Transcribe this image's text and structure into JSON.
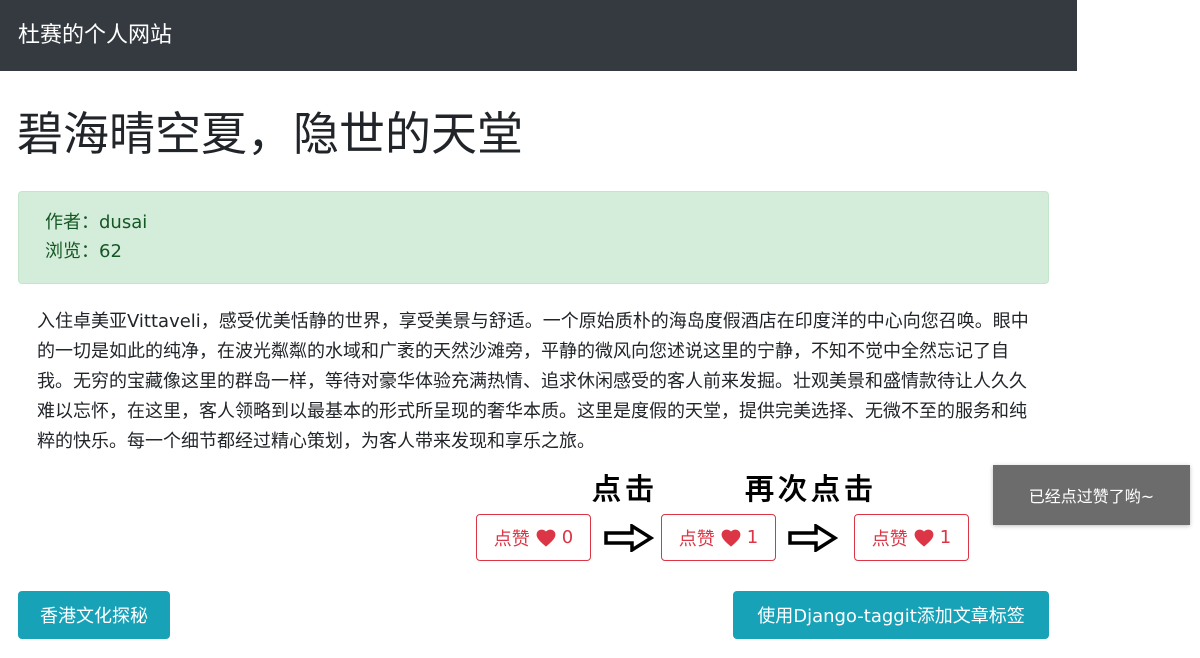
{
  "navbar": {
    "brand": "杜赛的个人网站"
  },
  "article": {
    "title": "碧海晴空夏，隐世的天堂",
    "author_line": "作者：dusai",
    "views_line": "浏览：62",
    "body": "入住卓美亚Vittaveli，感受优美恬静的世界，享受美景与舒适。一个原始质朴的海岛度假酒店在印度洋的中心向您召唤。眼中的一切是如此的纯净，在波光粼粼的水域和广袤的天然沙滩旁，平静的微风向您述说这里的宁静，不知不觉中全然忘记了自我。无穷的宝藏像这里的群岛一样，等待对豪华体验充满热情、追求休闲感受的客人前来发掘。壮观美景和盛情款待让人久久难以忘怀，在这里，客人领略到以最基本的形式所呈现的奢华本质。这里是度假的天堂，提供完美选择、无微不至的服务和纯粹的快乐。每一个细节都经过精心策划，为客人带来发现和享乐之旅。"
  },
  "annotations": {
    "step1": "点击",
    "step2": "再次点击"
  },
  "like_buttons": [
    {
      "label": "点赞",
      "count": "0",
      "icon": "heart-icon"
    },
    {
      "label": "点赞",
      "count": "1",
      "icon": "heart-icon"
    },
    {
      "label": "点赞",
      "count": "1",
      "icon": "heart-icon"
    }
  ],
  "toast": {
    "message": "已经点过赞了哟~"
  },
  "pagination": {
    "prev_label": "香港文化探秘",
    "next_label": "使用Django-taggit添加文章标签"
  },
  "colors": {
    "navbar_bg": "#343a40",
    "alert_bg": "#d4edda",
    "alert_text": "#155724",
    "like_red": "#dc3545",
    "nav_button": "#17a2b8",
    "toast_bg": "#6c6c6c"
  }
}
